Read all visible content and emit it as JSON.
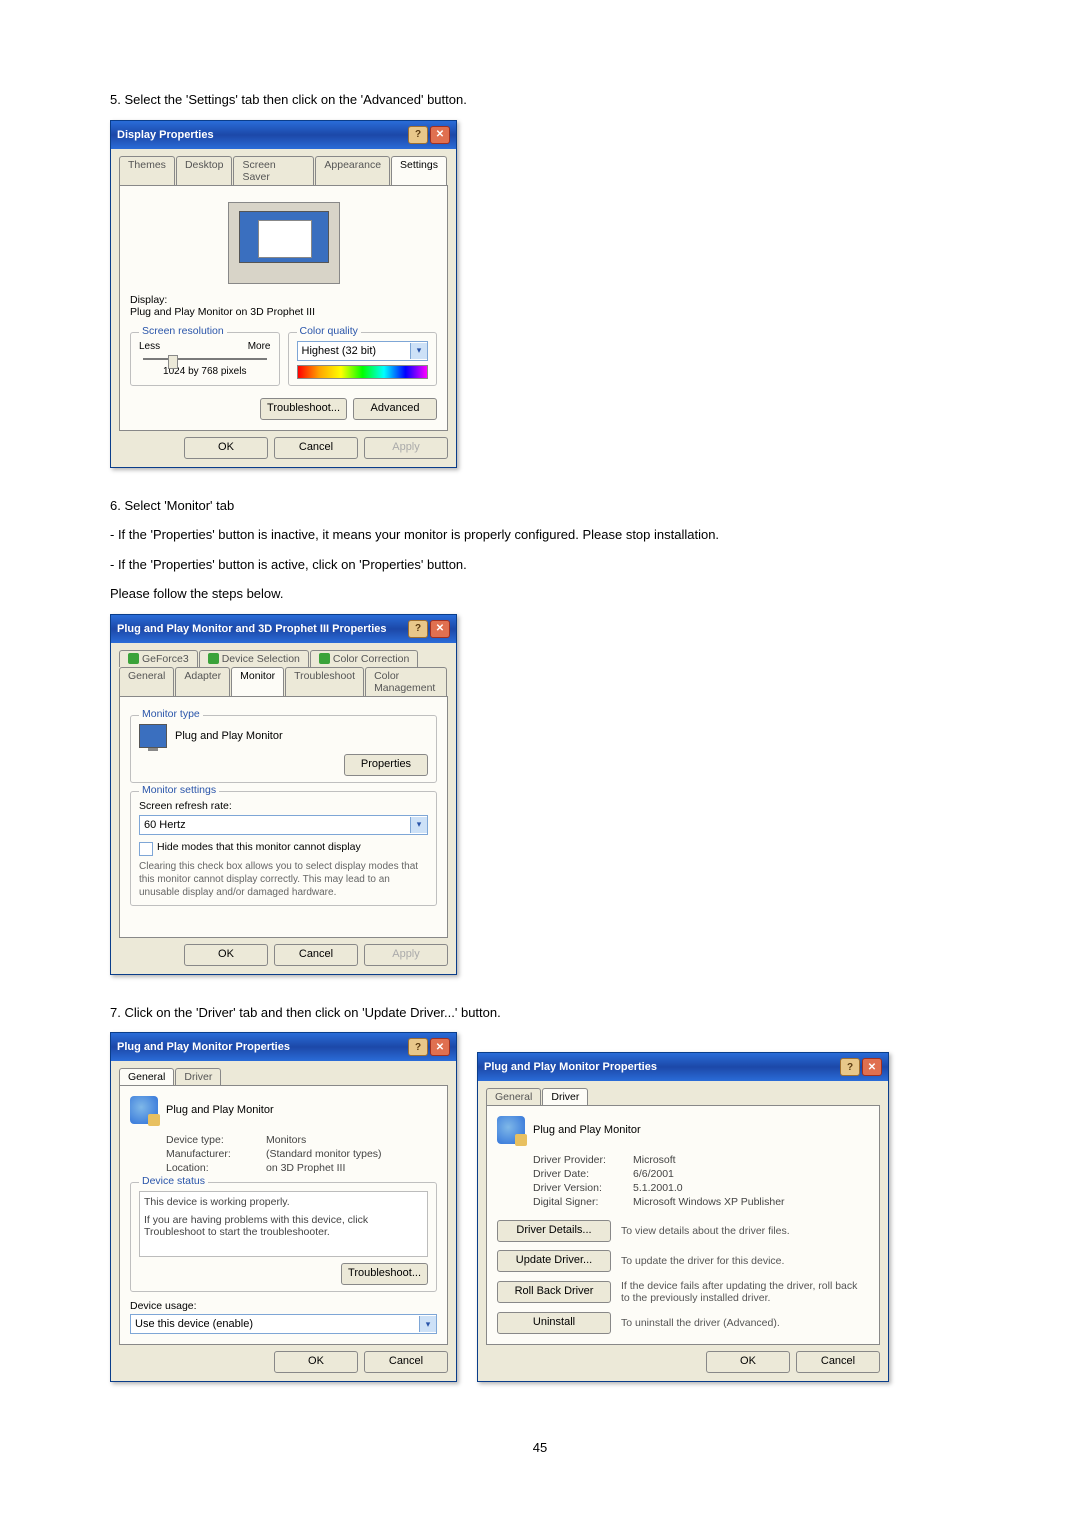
{
  "step5": {
    "text": "5. Select the 'Settings' tab then click on the 'Advanced' button."
  },
  "displayProps": {
    "title": "Display Properties",
    "tabs": [
      "Themes",
      "Desktop",
      "Screen Saver",
      "Appearance",
      "Settings"
    ],
    "displayLabel": "Display:",
    "displayValue": "Plug and Play Monitor on 3D Prophet III",
    "screenResGroup": "Screen resolution",
    "less": "Less",
    "more": "More",
    "resolutionText": "1024 by 768 pixels",
    "colorGroup": "Color quality",
    "colorValue": "Highest (32 bit)",
    "troubleshoot": "Troubleshoot...",
    "advanced": "Advanced",
    "ok": "OK",
    "cancel": "Cancel",
    "apply": "Apply"
  },
  "step6": {
    "line1": "6. Select 'Monitor' tab",
    "line2": "- If the 'Properties' button is inactive, it means your monitor is properly configured. Please stop installation.",
    "line3": "- If the 'Properties' button is active, click on 'Properties' button.",
    "line4": "Please follow the steps below."
  },
  "monitorProps": {
    "title": "Plug and Play Monitor and 3D Prophet III Properties",
    "topTabs": [
      "GeForce3",
      "Device Selection",
      "Color Correction"
    ],
    "bottomTabs": [
      "General",
      "Adapter",
      "Monitor",
      "Troubleshoot",
      "Color Management"
    ],
    "monitorTypeGroup": "Monitor type",
    "monitorTypeValue": "Plug and Play Monitor",
    "propertiesBtn": "Properties",
    "monitorSettingsGroup": "Monitor settings",
    "refreshLabel": "Screen refresh rate:",
    "refreshValue": "60 Hertz",
    "hideModes": "Hide modes that this monitor cannot display",
    "hideNote": "Clearing this check box allows you to select display modes that this monitor cannot display correctly. This may lead to an unusable display and/or damaged hardware.",
    "ok": "OK",
    "cancel": "Cancel",
    "apply": "Apply"
  },
  "step7": {
    "text": "7. Click on the 'Driver' tab and then click on 'Update Driver...' button."
  },
  "pnpGeneral": {
    "title": "Plug and Play Monitor Properties",
    "tabs": [
      "General",
      "Driver"
    ],
    "name": "Plug and Play Monitor",
    "devTypeK": "Device type:",
    "devTypeV": "Monitors",
    "mfrK": "Manufacturer:",
    "mfrV": "(Standard monitor types)",
    "locK": "Location:",
    "locV": "on 3D Prophet III",
    "statusGroup": "Device status",
    "statusLine1": "This device is working properly.",
    "statusLine2": "If you are having problems with this device, click Troubleshoot to start the troubleshooter.",
    "troubleshoot": "Troubleshoot...",
    "usageLabel": "Device usage:",
    "usageValue": "Use this device (enable)",
    "ok": "OK",
    "cancel": "Cancel"
  },
  "pnpDriver": {
    "title": "Plug and Play Monitor Properties",
    "tabs": [
      "General",
      "Driver"
    ],
    "name": "Plug and Play Monitor",
    "provK": "Driver Provider:",
    "provV": "Microsoft",
    "dateK": "Driver Date:",
    "dateV": "6/6/2001",
    "verK": "Driver Version:",
    "verV": "5.1.2001.0",
    "sigK": "Digital Signer:",
    "sigV": "Microsoft Windows XP Publisher",
    "detailsBtn": "Driver Details...",
    "detailsDesc": "To view details about the driver files.",
    "updateBtn": "Update Driver...",
    "updateDesc": "To update the driver for this device.",
    "rollbackBtn": "Roll Back Driver",
    "rollbackDesc": "If the device fails after updating the driver, roll back to the previously installed driver.",
    "uninstallBtn": "Uninstall",
    "uninstallDesc": "To uninstall the driver (Advanced).",
    "ok": "OK",
    "cancel": "Cancel"
  },
  "pageNumber": "45"
}
